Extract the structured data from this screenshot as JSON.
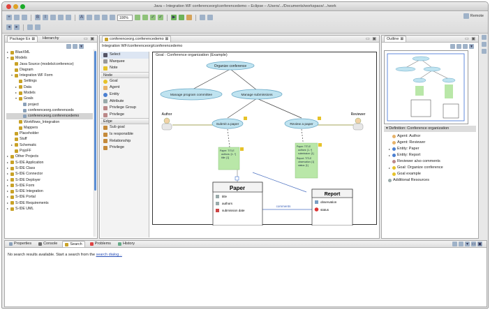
{
  "window": {
    "title": "Java – Integration WF conferenceorg/conferencedemo – Eclipse – /Users/.../Documents/workspace/.../work"
  },
  "toolbar": {
    "zoom_value": "100%",
    "perspective_label": "Remote"
  },
  "package_explorer": {
    "tabs": [
      "Package Ex",
      "Hierarchy"
    ],
    "items": [
      {
        "label": "BlueXML",
        "indent": 0,
        "twisty": "▸",
        "color": "#c9a227"
      },
      {
        "label": "Models",
        "indent": 0,
        "twisty": "▾",
        "color": "#c9a227"
      },
      {
        "label": "Java Source (models/conference)",
        "indent": 1,
        "twisty": "",
        "color": "#c9a227"
      },
      {
        "label": "Diagram",
        "indent": 1,
        "twisty": "",
        "color": "#c9a227"
      },
      {
        "label": "Integration WF Form",
        "indent": 1,
        "twisty": "▾",
        "color": "#c9a227"
      },
      {
        "label": "Settings",
        "indent": 2,
        "twisty": "",
        "color": "#c9a227"
      },
      {
        "label": "Data",
        "indent": 2,
        "twisty": "▸",
        "color": "#c9a227"
      },
      {
        "label": "Models",
        "indent": 2,
        "twisty": "▸",
        "color": "#c9a227"
      },
      {
        "label": "Goals",
        "indent": 2,
        "twisty": "▾",
        "color": "#c9a227"
      },
      {
        "label": "project",
        "indent": 3,
        "twisty": "",
        "color": "#8aa0b8"
      },
      {
        "label": "conferenceorg.conferenceds",
        "indent": 3,
        "twisty": "",
        "color": "#8aa0b8"
      },
      {
        "label": "conferenceorg.conferencedemo",
        "indent": 3,
        "twisty": "",
        "color": "#8aa0b8",
        "selected": true
      },
      {
        "label": "Workflows_Integration",
        "indent": 2,
        "twisty": "",
        "color": "#c9a227"
      },
      {
        "label": "Mappers",
        "indent": 2,
        "twisty": "",
        "color": "#c9a227"
      },
      {
        "label": "Placeholder",
        "indent": 1,
        "twisty": "",
        "color": "#c9a227"
      },
      {
        "label": "Stuff",
        "indent": 1,
        "twisty": "",
        "color": "#c9a227"
      },
      {
        "label": "Schematic",
        "indent": 1,
        "twisty": "▸",
        "color": "#c9a227"
      },
      {
        "label": "PojoFF",
        "indent": 1,
        "twisty": "",
        "color": "#c9a227"
      },
      {
        "label": "Other Projects",
        "indent": 0,
        "twisty": "▸",
        "color": "#c9a227"
      },
      {
        "label": "S-IDE Application",
        "indent": 0,
        "twisty": "▸",
        "color": "#c9a227"
      },
      {
        "label": "S-IDE Class",
        "indent": 0,
        "twisty": "▸",
        "color": "#c9a227"
      },
      {
        "label": "S-IDE Connector",
        "indent": 0,
        "twisty": "▸",
        "color": "#c9a227"
      },
      {
        "label": "S-IDE Deployer",
        "indent": 0,
        "twisty": "▸",
        "color": "#c9a227"
      },
      {
        "label": "S-IDE Form",
        "indent": 0,
        "twisty": "▸",
        "color": "#c9a227"
      },
      {
        "label": "S-IDE Integration",
        "indent": 0,
        "twisty": "▸",
        "color": "#c9a227"
      },
      {
        "label": "S-IDE Portal",
        "indent": 0,
        "twisty": "▸",
        "color": "#c9a227"
      },
      {
        "label": "S-IDE Requirements",
        "indent": 0,
        "twisty": "▸",
        "color": "#c9a227"
      },
      {
        "label": "S-IDE UML",
        "indent": 0,
        "twisty": "▸",
        "color": "#c9a227"
      }
    ]
  },
  "editor": {
    "tab_label": "conferenceorg.conferencedemo",
    "breadcrumb": "Integration WF/conferenceorg/conferencedemo",
    "goal_label": "Goal : Conference organization (Example)"
  },
  "palette": {
    "top_items": [
      {
        "label": "Select",
        "icon": "arrow",
        "selected": true
      },
      {
        "label": "Marquee",
        "icon": "marquee"
      },
      {
        "label": "Note",
        "icon": "note"
      }
    ],
    "node_header": "Node",
    "node_items": [
      {
        "label": "Goal",
        "icon": "goal"
      },
      {
        "label": "Agent",
        "icon": "agent"
      },
      {
        "label": "Entity",
        "icon": "entity"
      },
      {
        "label": "Attribute",
        "icon": "attribute"
      },
      {
        "label": "Privilege Group",
        "icon": "privilege"
      },
      {
        "label": "Privilege",
        "icon": "privilege"
      }
    ],
    "edge_header": "Edge",
    "edge_items": [
      {
        "label": "Sub goal",
        "icon": "edge"
      },
      {
        "label": "Is responsible",
        "icon": "edge"
      },
      {
        "label": "Relationship",
        "icon": "edge"
      },
      {
        "label": "Privilege",
        "icon": "edge"
      }
    ]
  },
  "diagram": {
    "goals": {
      "root": "Organize conference",
      "left": "Manage program committee",
      "mid": "Manage submissions",
      "sub1": "Submit a paper",
      "sub2": "Review a paper"
    },
    "agents": {
      "author": "Author",
      "reviewer": "Reviewer"
    },
    "notes": {
      "left": "Paper: TITLE\n  authors: [1..*]\n  title: [1]",
      "right": "Paper: TITLE\n  authors: [1..*]\n  submission: [1]\nReport: TITLE\n  observation: [1]\n  status: [1]"
    },
    "paper": {
      "title": "Paper",
      "attrs": [
        "title",
        "authors",
        "submission date"
      ]
    },
    "report": {
      "title": "Report",
      "attrs": [
        "observation",
        "status"
      ]
    },
    "relation_label": "comments"
  },
  "outline": {
    "tab_label": "Outline",
    "root_label": "Definition: Conference organization",
    "items": [
      {
        "label": "Agent: Author",
        "indent": 1,
        "twisty": ""
      },
      {
        "label": "Agent: Reviewer",
        "indent": 1,
        "twisty": ""
      },
      {
        "label": "Entity: Paper",
        "indent": 1,
        "twisty": "▸"
      },
      {
        "label": "Entity: Report",
        "indent": 1,
        "twisty": "▸"
      },
      {
        "label": "Reviewer a/so comments",
        "indent": 1,
        "twisty": ""
      },
      {
        "label": "Goal: Organize conference",
        "indent": 1,
        "twisty": "▸"
      },
      {
        "label": "Goal example",
        "indent": 1,
        "twisty": ""
      },
      {
        "label": "Additional Resources",
        "indent": 0,
        "twisty": ""
      }
    ]
  },
  "bottom": {
    "tabs": [
      "Properties",
      "Console",
      "Search",
      "Problems",
      "History"
    ],
    "active_tab": "Search",
    "message_prefix": "No search results available. Start a search from the",
    "message_link": "search dialog...",
    "message_suffix": ""
  },
  "colors": {
    "goal_fill": "#bfe3f0",
    "goal_stroke": "#6aa9c7",
    "note_fill": "#b9e7a8",
    "accent_blue": "#5b8fd6"
  }
}
